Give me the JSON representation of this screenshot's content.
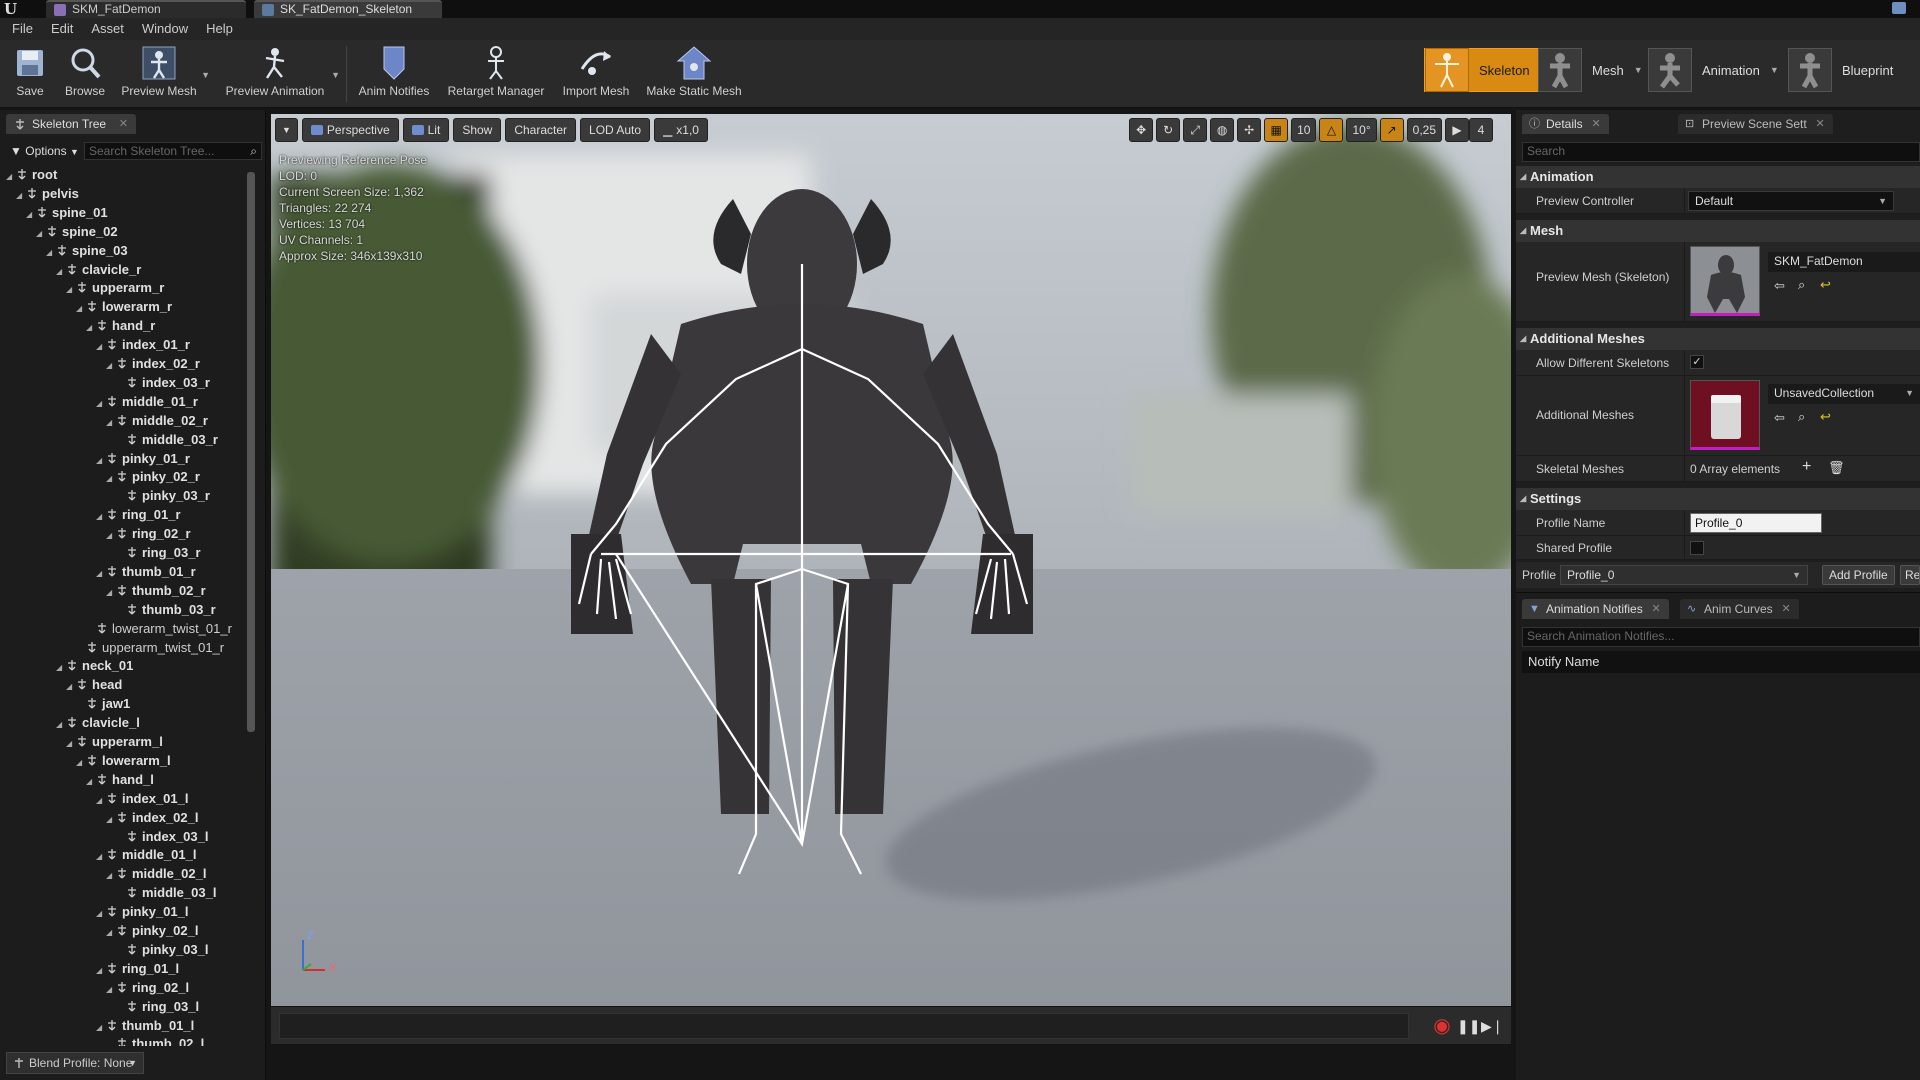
{
  "window": {
    "tabs": [
      {
        "label": "SKM_FatDemon",
        "active": false
      },
      {
        "label": "SK_FatDemon_Skeleton",
        "active": true
      }
    ]
  },
  "menu": [
    "File",
    "Edit",
    "Asset",
    "Window",
    "Help"
  ],
  "toolbar": {
    "buttons": [
      "Save",
      "Browse",
      "Preview Mesh",
      "Preview Animation",
      "Anim Notifies",
      "Retarget Manager",
      "Import Mesh",
      "Make Static Mesh"
    ],
    "modes": [
      {
        "label": "Skeleton",
        "selected": true
      },
      {
        "label": "Mesh",
        "selected": false
      },
      {
        "label": "Animation",
        "selected": false
      },
      {
        "label": "Blueprint",
        "selected": false
      }
    ]
  },
  "skeleton_tree": {
    "tab": "Skeleton Tree",
    "options_label": "Options",
    "search_placeholder": "Search Skeleton Tree...",
    "bones": [
      {
        "name": "root",
        "depth": 0
      },
      {
        "name": "pelvis",
        "depth": 1
      },
      {
        "name": "spine_01",
        "depth": 2
      },
      {
        "name": "spine_02",
        "depth": 3
      },
      {
        "name": "spine_03",
        "depth": 4
      },
      {
        "name": "clavicle_r",
        "depth": 5
      },
      {
        "name": "upperarm_r",
        "depth": 6
      },
      {
        "name": "lowerarm_r",
        "depth": 7
      },
      {
        "name": "hand_r",
        "depth": 8
      },
      {
        "name": "index_01_r",
        "depth": 9
      },
      {
        "name": "index_02_r",
        "depth": 10
      },
      {
        "name": "index_03_r",
        "depth": 11
      },
      {
        "name": "middle_01_r",
        "depth": 9
      },
      {
        "name": "middle_02_r",
        "depth": 10
      },
      {
        "name": "middle_03_r",
        "depth": 11
      },
      {
        "name": "pinky_01_r",
        "depth": 9
      },
      {
        "name": "pinky_02_r",
        "depth": 10
      },
      {
        "name": "pinky_03_r",
        "depth": 11
      },
      {
        "name": "ring_01_r",
        "depth": 9
      },
      {
        "name": "ring_02_r",
        "depth": 10
      },
      {
        "name": "ring_03_r",
        "depth": 11
      },
      {
        "name": "thumb_01_r",
        "depth": 9
      },
      {
        "name": "thumb_02_r",
        "depth": 10
      },
      {
        "name": "thumb_03_r",
        "depth": 11
      },
      {
        "name": "lowerarm_twist_01_r",
        "depth": 8,
        "light": true
      },
      {
        "name": "upperarm_twist_01_r",
        "depth": 7,
        "light": true
      },
      {
        "name": "neck_01",
        "depth": 5
      },
      {
        "name": "head",
        "depth": 6
      },
      {
        "name": "jaw1",
        "depth": 7
      },
      {
        "name": "clavicle_l",
        "depth": 5
      },
      {
        "name": "upperarm_l",
        "depth": 6
      },
      {
        "name": "lowerarm_l",
        "depth": 7
      },
      {
        "name": "hand_l",
        "depth": 8
      },
      {
        "name": "index_01_l",
        "depth": 9
      },
      {
        "name": "index_02_l",
        "depth": 10
      },
      {
        "name": "index_03_l",
        "depth": 11
      },
      {
        "name": "middle_01_l",
        "depth": 9
      },
      {
        "name": "middle_02_l",
        "depth": 10
      },
      {
        "name": "middle_03_l",
        "depth": 11
      },
      {
        "name": "pinky_01_l",
        "depth": 9
      },
      {
        "name": "pinky_02_l",
        "depth": 10
      },
      {
        "name": "pinky_03_l",
        "depth": 11
      },
      {
        "name": "ring_01_l",
        "depth": 9
      },
      {
        "name": "ring_02_l",
        "depth": 10
      },
      {
        "name": "ring_03_l",
        "depth": 11
      },
      {
        "name": "thumb_01_l",
        "depth": 9
      },
      {
        "name": "thumb_02_l",
        "depth": 10
      }
    ],
    "blend_profile": "Blend Profile: None"
  },
  "viewport": {
    "toolbar": [
      "Perspective",
      "Lit",
      "Show",
      "Character",
      "LOD Auto",
      "x1,0"
    ],
    "right_values": {
      "grid": "10",
      "angle": "10°",
      "scale": "0,25",
      "camera_speed": "4"
    },
    "stats": [
      "Previewing Reference Pose",
      "LOD: 0",
      "Current Screen Size: 1,362",
      "Triangles: 22 274",
      "Vertices: 13 704",
      "UV Channels: 1",
      "Approx Size: 346x139x310"
    ],
    "axis": {
      "z": "Z",
      "x": "X"
    }
  },
  "details": {
    "tabs": [
      "Details",
      "Preview Scene Sett"
    ],
    "search_placeholder": "Search",
    "sections": {
      "animation": "Animation",
      "mesh": "Mesh",
      "additional_meshes": "Additional Meshes",
      "settings": "Settings"
    },
    "preview_controller_label": "Preview Controller",
    "preview_controller_value": "Default",
    "preview_mesh_label": "Preview Mesh (Skeleton)",
    "preview_mesh_value": "SKM_FatDemon",
    "allow_diff_label": "Allow Different Skeletons",
    "allow_diff_checked": true,
    "additional_meshes_label": "Additional Meshes",
    "additional_meshes_value": "UnsavedCollection",
    "skeletal_meshes_label": "Skeletal Meshes",
    "skeletal_meshes_value": "0 Array elements",
    "profile_name_label": "Profile Name",
    "profile_name_value": "Profile_0",
    "shared_profile_label": "Shared Profile",
    "profile_label": "Profile",
    "profile_value": "Profile_0",
    "add_profile": "Add Profile",
    "remove_profile": "Re"
  },
  "notifies": {
    "tabs": [
      "Animation Notifies",
      "Anim Curves"
    ],
    "search_placeholder": "Search Animation Notifies...",
    "column": "Notify Name"
  },
  "colors": {
    "accent": "#d88a12",
    "bg": "#1c1c1c"
  }
}
